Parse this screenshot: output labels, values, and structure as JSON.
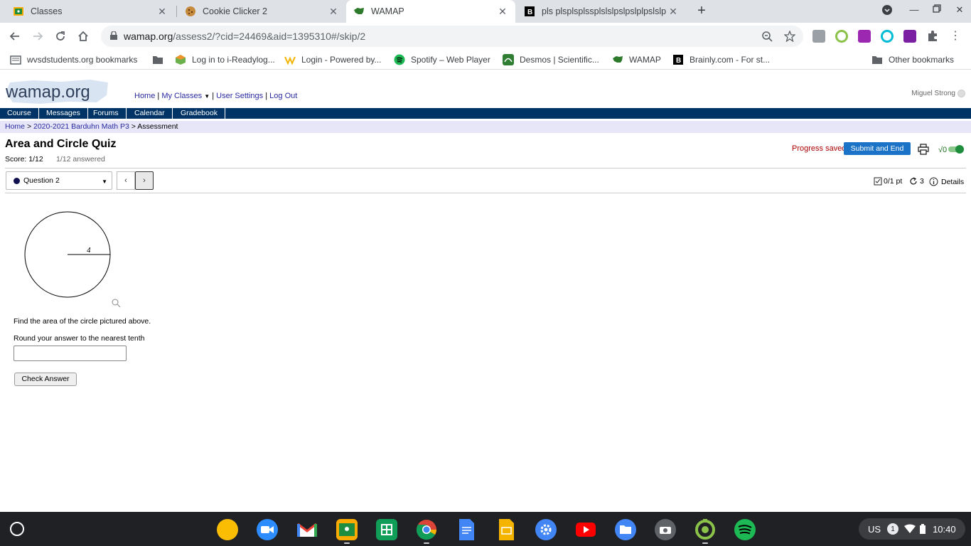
{
  "browser": {
    "tabs": [
      {
        "title": "Classes",
        "icon": "google-classroom-icon",
        "active": false
      },
      {
        "title": "Cookie Clicker 2",
        "icon": "cookie-icon",
        "active": false
      },
      {
        "title": "WAMAP",
        "icon": "wamap-icon",
        "active": true
      },
      {
        "title": "pls plsplsplssplslslpslpslplpslslp",
        "icon": "brainly-icon",
        "active": false
      }
    ],
    "url_domain": "wamap.org",
    "url_path": "/assess2/?cid=24469&aid=1395310#/skip/2",
    "bookmarks": [
      {
        "label": "wvsdstudents.org bookmarks",
        "icon": "folder-icon"
      },
      {
        "label": "",
        "icon": "folder-icon"
      },
      {
        "label": "Log in to i-Readylog...",
        "icon": "iready-icon"
      },
      {
        "label": "Login - Powered by...",
        "icon": "w-logo-icon"
      },
      {
        "label": "Spotify – Web Player",
        "icon": "spotify-icon"
      },
      {
        "label": "Desmos | Scientific...",
        "icon": "desmos-icon"
      },
      {
        "label": "WAMAP",
        "icon": "wamap-icon"
      },
      {
        "label": "Brainly.com - For st...",
        "icon": "brainly-icon"
      },
      {
        "label": "Other bookmarks",
        "icon": "folder-icon"
      }
    ]
  },
  "site": {
    "logo_text": "wamap.org",
    "topnav": {
      "home": "Home",
      "my_classes": "My Classes",
      "user_settings": "User Settings",
      "log_out": "Log Out"
    },
    "username": "Miguel Strong",
    "menu": [
      "Course",
      "Messages",
      "Forums",
      "Calendar",
      "Gradebook"
    ],
    "breadcrumb": {
      "home": "Home",
      "course": "2020-2021 Barduhn Math P3",
      "current": "Assessment",
      "separator": ">"
    }
  },
  "assessment": {
    "title": "Area and Circle Quiz",
    "score": "Score: 1/12",
    "answered": "1/12 answered",
    "progress_saved": "Progress saved",
    "submit_label": "Submit and End",
    "math_toggle_label": "√0",
    "question_selector": "Question 2",
    "prev_label": "‹",
    "next_label": "›",
    "points": "0/1 pt",
    "retries": "3",
    "details_label": "Details"
  },
  "question": {
    "radius_label": "4",
    "prompt": "Find the area of the circle pictured above.",
    "instruction": "Round your answer to the nearest tenth",
    "answer_value": "",
    "check_label": "Check Answer"
  },
  "shelf": {
    "apps": [
      "keep-icon",
      "zoom-icon",
      "gmail-icon",
      "google-classroom-icon",
      "sheets-icon",
      "chrome-icon",
      "docs-icon",
      "slides-icon",
      "settings-icon",
      "youtube-icon",
      "files-icon",
      "camera-icon",
      "screencastify-icon",
      "spotify-icon"
    ],
    "locale": "US",
    "notification_count": "1",
    "time": "10:40"
  },
  "colors": {
    "nav_bar": "#003466",
    "breadcrumb_bg": "#e6e6f8",
    "submit_button": "#1a73c7",
    "saved_text": "#aa0000",
    "link": "#2a2aa0"
  }
}
